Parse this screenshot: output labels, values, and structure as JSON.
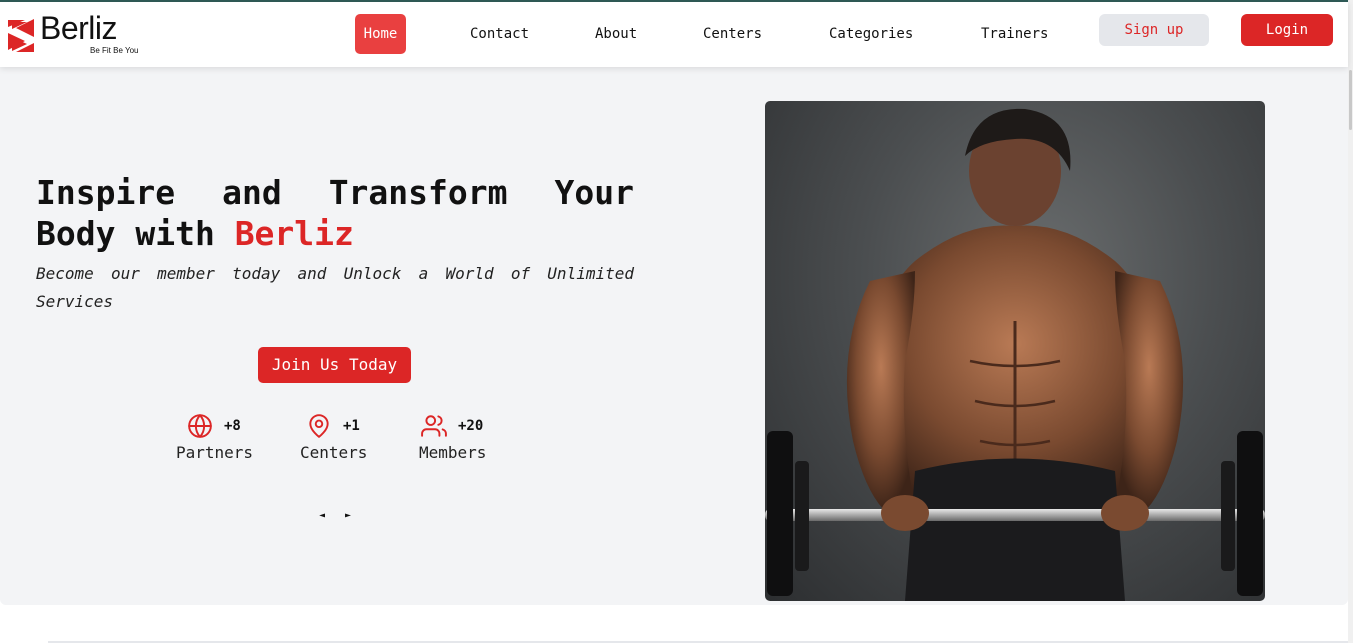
{
  "brand": {
    "name": "Berliz",
    "tagline": "Be Fit Be You",
    "accent_color": "#dc2626"
  },
  "nav": {
    "items": [
      {
        "label": "Home",
        "active": true
      },
      {
        "label": "Contact"
      },
      {
        "label": "About"
      },
      {
        "label": "Centers"
      },
      {
        "label": "Categories"
      },
      {
        "label": "Trainers"
      }
    ],
    "signup_label": "Sign up",
    "login_label": "Login"
  },
  "hero": {
    "title_words": [
      "Inspire",
      "and",
      "Transform",
      "Your"
    ],
    "title_line2_prefix": "Body with",
    "title_brand": "Berliz",
    "subtitle": "Become our member today and Unlock a World of Unlimited Services",
    "cta_label": "Join Us Today",
    "stats": [
      {
        "icon": "globe-icon",
        "value": "+8",
        "label": "Partners"
      },
      {
        "icon": "map-pin-icon",
        "value": "+1",
        "label": "Centers"
      },
      {
        "icon": "users-icon",
        "value": "+20",
        "label": "Members"
      }
    ],
    "carousel_prev": "◄",
    "carousel_next": "►"
  }
}
